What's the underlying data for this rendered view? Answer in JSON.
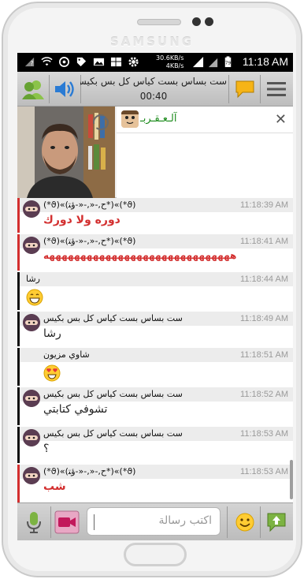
{
  "device": {
    "brand": "SAMSUNG"
  },
  "status_bar": {
    "speed_up": "30.6KB/s",
    "speed_down": "4KB/s",
    "battery": "79",
    "time": "11:18 AM",
    "icons": [
      "question-icon",
      "wifi-icon",
      "sync-icon",
      "tag-icon",
      "image-icon",
      "windows-icon",
      "gear-icon",
      "signal-icon",
      "sim-icon",
      "battery-icon"
    ]
  },
  "header": {
    "room_title": "ست بساس بست كياس كل بس بكيس",
    "timer": "00:40"
  },
  "video": {
    "speaker_name": "آلـعـقـربـ"
  },
  "messages": [
    {
      "user": "(*ϑ)«(ح,-«,-«-ﺅﺘ*)«(*ϑ)",
      "time": "11:18:39 AM",
      "text": "دوره ولا دورك",
      "style": "red"
    },
    {
      "user": "(*ϑ)«(ح,-«,-«-ﺅﺘ*)«(*ϑ)",
      "time": "11:18:41 AM",
      "text": "ههههههههههههههههههههههههههههههه",
      "style": "red"
    },
    {
      "user": "رشا",
      "time": "11:18:44 AM",
      "text": "",
      "emoji": "grin",
      "style": "black"
    },
    {
      "user": "ست بساس بست كياس كل بس بكيس",
      "time": "11:18:49 AM",
      "text": "رشا",
      "style": "black"
    },
    {
      "user": "شاوي مزيون",
      "time": "11:18:51 AM",
      "text": "",
      "emoji": "heart-eyes",
      "style": "black"
    },
    {
      "user": "ست بساس بست كياس كل بس بكيس",
      "time": "11:18:52 AM",
      "text": "تشوفي كتابتي",
      "style": "black"
    },
    {
      "user": "ست بساس بست كياس كل بس بكيس",
      "time": "11:18:53 AM",
      "text": "؟",
      "style": "black"
    },
    {
      "user": "(*ϑ)«(ح,-«,-«-ﺅﺘ*)«(*ϑ)",
      "time": "11:18:53 AM",
      "text": "شب",
      "style": "red"
    }
  ],
  "input": {
    "placeholder": "اكتب رسالة"
  },
  "colors": {
    "accent_red": "#d32f2f",
    "speaker_green": "#1a8a1a",
    "header_bg": "#c9c9c9"
  }
}
